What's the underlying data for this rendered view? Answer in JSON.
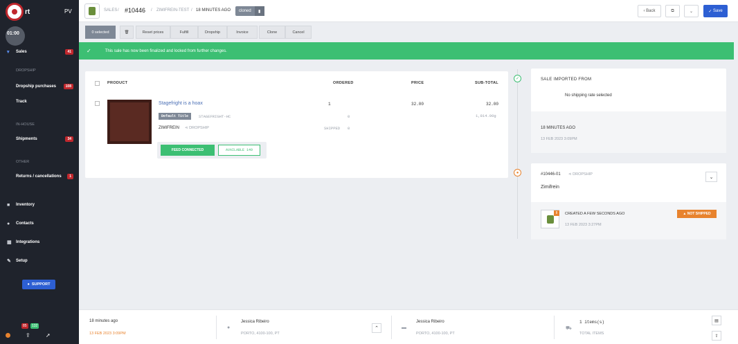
{
  "sidebar": {
    "logo_text": "rt",
    "pv": "PV",
    "avatar": "01:00",
    "items": [
      {
        "label": "Sales",
        "badge": "41"
      },
      {
        "label": "Dropship purchases",
        "badge": "108"
      },
      {
        "label": "Track"
      },
      {
        "label": "Shipments",
        "badge": "34"
      },
      {
        "label": "Returns / cancellations",
        "badge": "1"
      },
      {
        "label": "Inventory"
      },
      {
        "label": "Contacts"
      },
      {
        "label": "Integrations"
      },
      {
        "label": "Setup"
      }
    ],
    "sections": [
      "DROPSHIP",
      "IN-HOUSE",
      "OTHER"
    ],
    "support": "SUPPORT",
    "badge_a": "85",
    "badge_b": "132"
  },
  "header": {
    "crumb_sales": "SALES",
    "order": "#10446",
    "shop": "ZIMIFREIN-TEST",
    "time": "18 MINUTES AGO",
    "cloned": "cloned",
    "back": "Back",
    "save": "Save"
  },
  "actions": [
    "0 selected",
    "Reset prices",
    "Fulfill",
    "Dropship",
    "Invoice",
    "Clone",
    "Cancel"
  ],
  "banner": "This sale has now been finalized and locked from further changes.",
  "table": {
    "headers": [
      "PRODUCT",
      "ORDERED",
      "PRICE",
      "SUB-TOTAL"
    ],
    "item": {
      "name": "Stagefright is a hoax",
      "variant": "Default Title",
      "sku": "STAGEFRIGHT-HC",
      "ordered": "1",
      "price": "32.00",
      "subtotal": "32.00",
      "weight": "1,814.00g",
      "shipped_label": "SHIPPED",
      "shipped": "0",
      "zero": "0",
      "vendor": "ZIMIFREIN",
      "dropship": "DROPSHIP",
      "feed": "FEED CONNECTED",
      "available": "AVAILABLE 149"
    }
  },
  "timeline": {
    "import_title": "SALE IMPORTED FROM",
    "no_rate": "No shipping rate selected",
    "import_ago": "18 MINUTES AGO",
    "import_date": "13 FEB 2023 3:09PM",
    "ds_id": "#10446-01",
    "ds_label": "DROPSHIP",
    "ds_name": "Zimifrein",
    "created": "CREATED A FEW SECONDS AGO",
    "created_date": "13 FEB 2023 3:27PM",
    "status": "NOT SHIPPED"
  },
  "bottom": {
    "ago": "18 minutes ago",
    "date": "13 FEB 2023 3:09PM",
    "c1_name": "Jessica Ribeiro",
    "c1_addr": "PORTO, 4100-100, PT",
    "c2_name": "Jessica Ribeiro",
    "c2_addr": "PORTO, 4100-100, PT",
    "items": "1 items(s)",
    "items_label": "TOTAL ITEMS"
  }
}
